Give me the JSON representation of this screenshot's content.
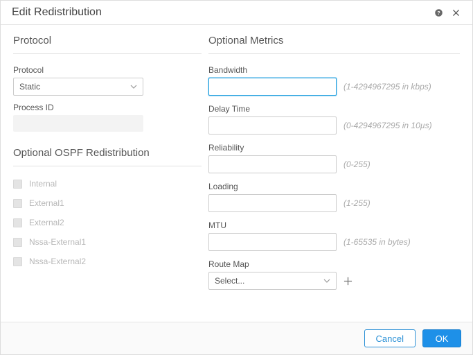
{
  "header": {
    "title": "Edit Redistribution"
  },
  "left": {
    "protocol_section": "Protocol",
    "protocol_label": "Protocol",
    "protocol_value": "Static",
    "process_id_label": "Process ID",
    "ospf_section": "Optional OSPF Redistribution",
    "checks": [
      {
        "label": "Internal"
      },
      {
        "label": "External1"
      },
      {
        "label": "External2"
      },
      {
        "label": "Nssa-External1"
      },
      {
        "label": "Nssa-External2"
      }
    ]
  },
  "right": {
    "section": "Optional Metrics",
    "bandwidth_label": "Bandwidth",
    "bandwidth_value": "",
    "bandwidth_hint": "(1-4294967295 in kbps)",
    "delay_label": "Delay Time",
    "delay_hint": "(0-4294967295 in 10µs)",
    "reliability_label": "Reliability",
    "reliability_hint": "(0-255)",
    "loading_label": "Loading",
    "loading_hint": "(1-255)",
    "mtu_label": "MTU",
    "mtu_hint": "(1-65535 in bytes)",
    "routemap_label": "Route Map",
    "routemap_value": "Select..."
  },
  "footer": {
    "cancel": "Cancel",
    "ok": "OK"
  }
}
